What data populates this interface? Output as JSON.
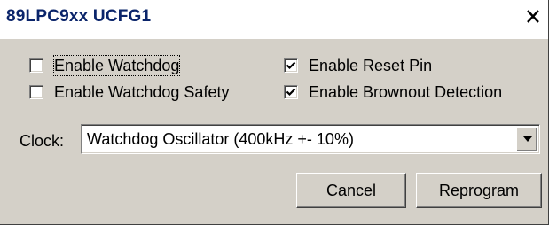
{
  "window": {
    "title": "89LPC9xx UCFG1",
    "close_glyph": "close-icon"
  },
  "options": {
    "enable_watchdog": {
      "label": "Enable Watchdog",
      "checked": false
    },
    "enable_watchdog_safety": {
      "label": "Enable Watchdog Safety",
      "checked": false
    },
    "enable_reset_pin": {
      "label": "Enable Reset Pin",
      "checked": true
    },
    "enable_brownout_detection": {
      "label": "Enable Brownout Detection",
      "checked": true
    }
  },
  "clock": {
    "label": "Clock:",
    "selected": "Watchdog Oscillator (400kHz +- 10%)"
  },
  "buttons": {
    "cancel": "Cancel",
    "reprogram": "Reprogram"
  },
  "colors": {
    "title_text": "#0a246a",
    "dialog_face": "#d4d0c8"
  }
}
